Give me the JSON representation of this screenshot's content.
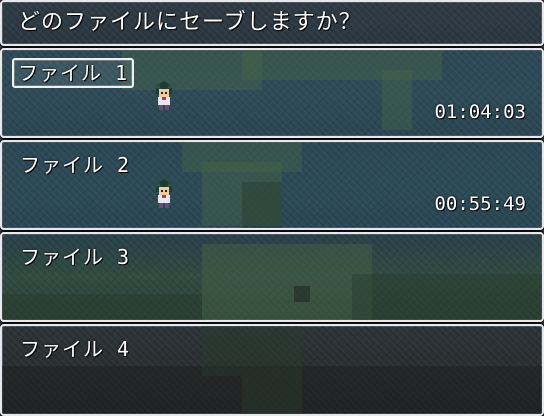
{
  "help": {
    "text": "どのファイルにセーブしますか？"
  },
  "slots": [
    {
      "label": "ファイル 1",
      "playtime": "01:04:03",
      "selected": true,
      "has_character": true
    },
    {
      "label": "ファイル 2",
      "playtime": "00:55:49",
      "selected": false,
      "has_character": true
    },
    {
      "label": "ファイル 3",
      "playtime": "",
      "selected": false,
      "has_character": false
    },
    {
      "label": "ファイル 4",
      "playtime": "",
      "selected": false,
      "has_character": false
    }
  ],
  "colors": {
    "window_border": "#e8e8ec",
    "text": "#ffffff"
  }
}
